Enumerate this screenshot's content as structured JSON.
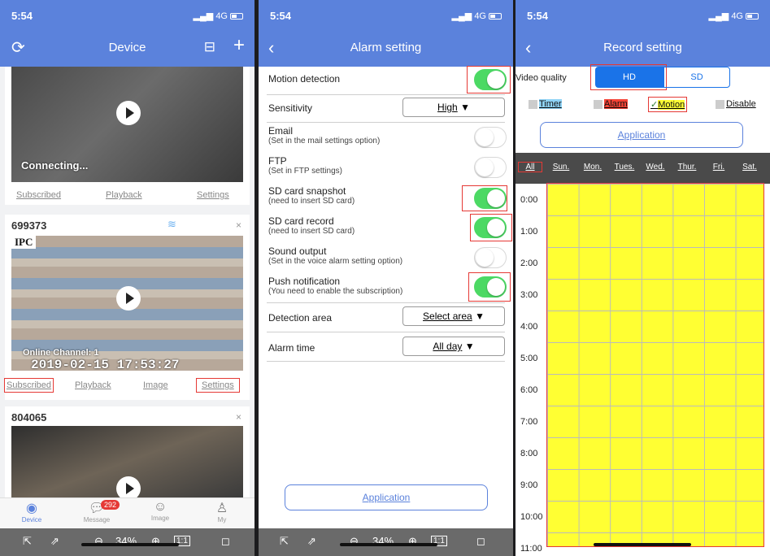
{
  "status": {
    "time": "5:54",
    "network": "4G"
  },
  "device_screen": {
    "title": "Device",
    "cards": [
      {
        "status": "Connecting...",
        "actions": [
          "Subscribed",
          "Playback",
          "Settings"
        ]
      },
      {
        "name": "699373",
        "overlay_top": "IPC",
        "overlay_channel": "Online Channel: 1",
        "overlay_time": "2019-02-15 17:53:27",
        "actions": [
          "Subscribed",
          "Playback",
          "Image",
          "Settings"
        ]
      },
      {
        "name": "804065"
      }
    ],
    "tabs": [
      {
        "label": "Device"
      },
      {
        "label": "Message",
        "badge": "292"
      },
      {
        "label": "Image"
      },
      {
        "label": "My"
      }
    ]
  },
  "alarm_screen": {
    "title": "Alarm setting",
    "motion_detection": {
      "label": "Motion detection",
      "on": true
    },
    "sensitivity": {
      "label": "Sensitivity",
      "value": "High"
    },
    "email": {
      "label": "Email",
      "sub": "(Set in the mail settings option)",
      "on": false
    },
    "ftp": {
      "label": "FTP",
      "sub": "(Set in FTP settings)",
      "on": false
    },
    "sd_snapshot": {
      "label": "SD card snapshot",
      "sub": "(need to insert SD card)",
      "on": true
    },
    "sd_record": {
      "label": "SD card record",
      "sub": "(need to insert SD card)",
      "on": true
    },
    "sound_output": {
      "label": "Sound output",
      "sub": "(Set in the voice alarm setting option)",
      "on": false
    },
    "push": {
      "label": "Push notification",
      "sub": "(You need to enable the subscription)",
      "on": true
    },
    "detection_area": {
      "label": "Detection area",
      "value": "Select area"
    },
    "alarm_time": {
      "label": "Alarm time",
      "value": "All day"
    },
    "apply": "Application"
  },
  "record_screen": {
    "title": "Record setting",
    "video_quality": {
      "label": "Video quality",
      "options": [
        "HD",
        "SD"
      ],
      "selected": "HD"
    },
    "legend": [
      "Timer",
      "Alarm",
      "Motion",
      "Disable"
    ],
    "apply": "Application",
    "columns": [
      "All",
      "Sun.",
      "Mon.",
      "Tues.",
      "Wed.",
      "Thur.",
      "Fri.",
      "Sat."
    ],
    "hours": [
      "0:00",
      "1:00",
      "2:00",
      "3:00",
      "4:00",
      "5:00",
      "6:00",
      "7:00",
      "8:00",
      "9:00",
      "10:00",
      "11:00"
    ],
    "fill_color": "#ffff33"
  },
  "toolbar": {
    "zoom": "34%",
    "ratio": "1:1"
  }
}
